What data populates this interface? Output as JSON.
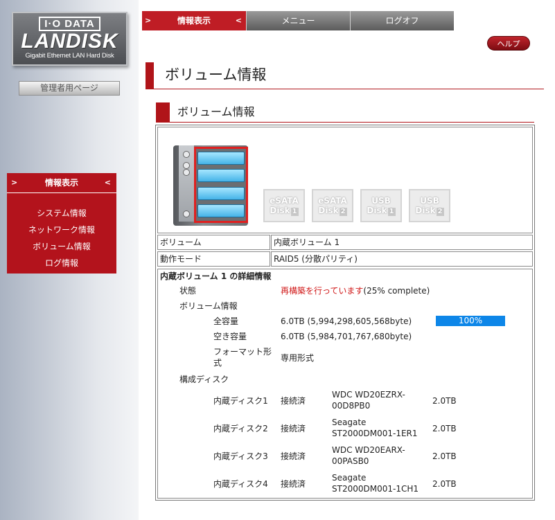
{
  "logo": {
    "brand": "I·O DATA",
    "product": "LANDISK",
    "tagline": "Gigabit Ethernet LAN Hard Disk"
  },
  "admin_page": "管理者用ページ",
  "topnav": {
    "tabs": [
      "情報表示",
      "メニュー",
      "ログオフ"
    ],
    "active": 0
  },
  "help": "ヘルプ",
  "sidenav": {
    "title": "情報表示",
    "items": [
      "システム情報",
      "ネットワーク情報",
      "ボリューム情報",
      "ログ情報"
    ]
  },
  "page_title": "ボリューム情報",
  "section_title": "ボリューム情報",
  "external_disks": [
    {
      "type": "eSATA",
      "label": "Disk",
      "num": "1"
    },
    {
      "type": "eSATA",
      "label": "Disk",
      "num": "2"
    },
    {
      "type": "USB",
      "label": "Disk",
      "num": "1"
    },
    {
      "type": "USB",
      "label": "Disk",
      "num": "2"
    }
  ],
  "volume": {
    "label": "ボリューム",
    "value": "内蔵ボリューム 1"
  },
  "mode": {
    "label": "動作モード",
    "value": "RAID5 (分散パリティ)"
  },
  "detail": {
    "heading": "内蔵ボリューム 1 の詳細情報",
    "status_label": "状態",
    "status_highlight": "再構築を行っています",
    "status_suffix": "(25% complete)",
    "volinfo_label": "ボリューム情報",
    "total_label": "全容量",
    "total_value": "6.0TB (5,994,298,605,568byte)",
    "usage_percent": "100%",
    "free_label": "空き容量",
    "free_value": "6.0TB (5,984,701,767,680byte)",
    "format_label": "フォーマット形式",
    "format_value": "専用形式",
    "disks_label": "構成ディスク",
    "disks": [
      {
        "name": "内蔵ディスク1",
        "status": "接続済",
        "model": "WDC WD20EZRX-00D8PB0",
        "size": "2.0TB"
      },
      {
        "name": "内蔵ディスク2",
        "status": "接続済",
        "model": "Seagate ST2000DM001-1ER1",
        "size": "2.0TB"
      },
      {
        "name": "内蔵ディスク3",
        "status": "接続済",
        "model": "WDC WD20EARX-00PASB0",
        "size": "2.0TB"
      },
      {
        "name": "内蔵ディスク4",
        "status": "接続済",
        "model": "Seagate ST2000DM001-1CH1",
        "size": "2.0TB"
      }
    ]
  }
}
